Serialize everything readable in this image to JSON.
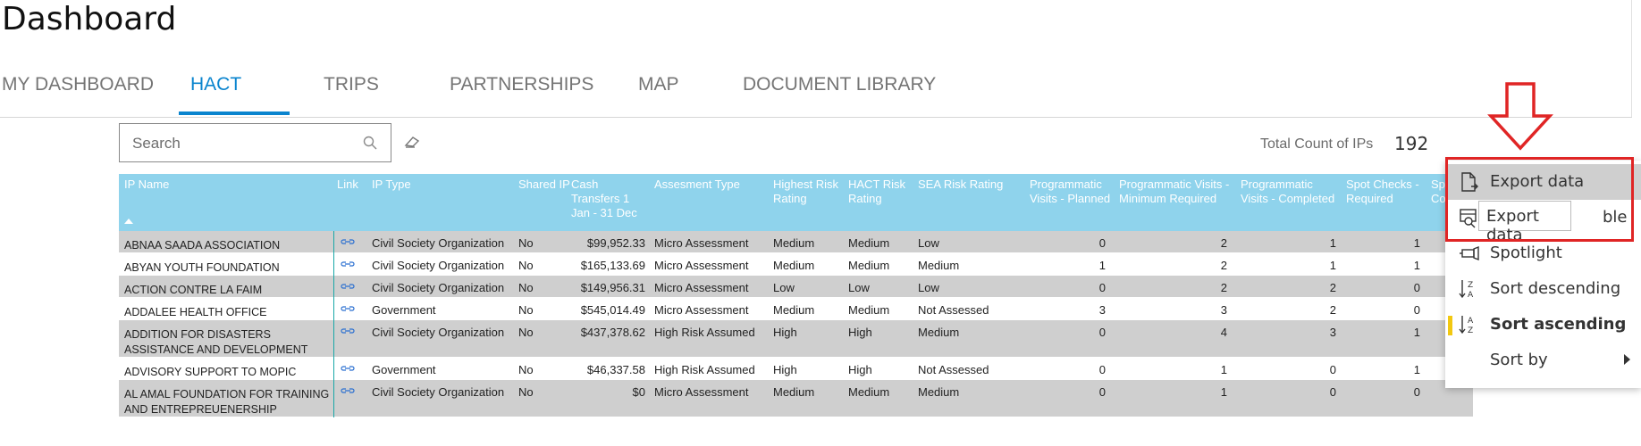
{
  "page": {
    "title": "Dashboard"
  },
  "tabs": [
    {
      "label": "MY DASHBOARD",
      "active": false
    },
    {
      "label": "HACT",
      "active": true
    },
    {
      "label": "TRIPS",
      "active": false
    },
    {
      "label": "PARTNERSHIPS",
      "active": false
    },
    {
      "label": "MAP",
      "active": false
    },
    {
      "label": "DOCUMENT LIBRARY",
      "active": false
    }
  ],
  "search": {
    "placeholder": "Search",
    "value": ""
  },
  "summary": {
    "label": "Total Count of IPs",
    "value": "192"
  },
  "table": {
    "columns": [
      "IP Name",
      "Link",
      "IP Type",
      "Shared IP",
      "Cash Transfers 1 Jan - 31 Dec",
      "Assesment Type",
      "Highest Risk Rating",
      "HACT Risk Rating",
      "SEA Risk Rating",
      "Programmatic Visits - Planned",
      "Programmatic Visits - Minimum Required",
      "Programmatic Visits - Completed",
      "Spot Checks - Required",
      "Sp... Co..."
    ],
    "sort": "IP Name ascending",
    "rows": [
      {
        "name": "ABNAA SAADA ASSOCIATION",
        "type": "Civil Society Organization",
        "shared": "No",
        "cash": "$99,952.33",
        "assess": "Micro Assessment",
        "highest": "Medium",
        "hact": "Medium",
        "sea": "Low",
        "planned": "0",
        "minreq": "2",
        "completed": "1",
        "spot": "1"
      },
      {
        "name": "ABYAN YOUTH FOUNDATION",
        "type": "Civil Society Organization",
        "shared": "No",
        "cash": "$165,133.69",
        "assess": "Micro Assessment",
        "highest": "Medium",
        "hact": "Medium",
        "sea": "Medium",
        "planned": "1",
        "minreq": "2",
        "completed": "1",
        "spot": "1"
      },
      {
        "name": "ACTION CONTRE LA FAIM",
        "type": "Civil Society Organization",
        "shared": "No",
        "cash": "$149,956.31",
        "assess": "Micro Assessment",
        "highest": "Low",
        "hact": "Low",
        "sea": "Low",
        "planned": "0",
        "minreq": "2",
        "completed": "2",
        "spot": "0"
      },
      {
        "name": "ADDALEE HEALTH OFFICE",
        "type": "Government",
        "shared": "No",
        "cash": "$545,014.49",
        "assess": "Micro Assessment",
        "highest": "Medium",
        "hact": "Medium",
        "sea": "Not Assessed",
        "planned": "3",
        "minreq": "3",
        "completed": "2",
        "spot": "0"
      },
      {
        "name": "ADDITION FOR DISASTERS ASSISTANCE AND DEVELOPMENT ADD",
        "type": "Civil Society Organization",
        "shared": "No",
        "cash": "$437,378.62",
        "assess": "High Risk Assumed",
        "highest": "High",
        "hact": "High",
        "sea": "Medium",
        "planned": "0",
        "minreq": "4",
        "completed": "3",
        "spot": "1"
      },
      {
        "name": "ADVISORY SUPPORT TO MOPIC",
        "type": "Government",
        "shared": "No",
        "cash": "$46,337.58",
        "assess": "High Risk Assumed",
        "highest": "High",
        "hact": "High",
        "sea": "Not Assessed",
        "planned": "0",
        "minreq": "1",
        "completed": "0",
        "spot": "1"
      },
      {
        "name": "AL AMAL FOUNDATION FOR TRAINING AND ENTREPREUENERSHIP",
        "type": "Civil Society Organization",
        "shared": "No",
        "cash": "$0",
        "assess": "Micro Assessment",
        "highest": "Medium",
        "hact": "Medium",
        "sea": "Medium",
        "planned": "0",
        "minreq": "1",
        "completed": "0",
        "spot": "0"
      }
    ]
  },
  "context_menu": {
    "items": [
      {
        "label": "Export data",
        "icon": "export-icon"
      },
      {
        "label": "Show as a table",
        "visible_text": "ble",
        "icon": "table-icon"
      },
      {
        "label": "Spotlight",
        "icon": "spotlight-icon"
      },
      {
        "label": "Sort descending",
        "icon": "sort-descending-icon"
      },
      {
        "label": "Sort ascending",
        "icon": "sort-ascending-icon",
        "selected": true
      },
      {
        "label": "Sort by",
        "icon": "chevron-right-icon"
      }
    ],
    "tooltip": "Export data"
  },
  "colors": {
    "accent": "#0a84ce",
    "header": "#8fd3ec",
    "row_shade": "#cfcfcf",
    "annotation": "#e02525",
    "selected_marker": "#f2c811"
  }
}
